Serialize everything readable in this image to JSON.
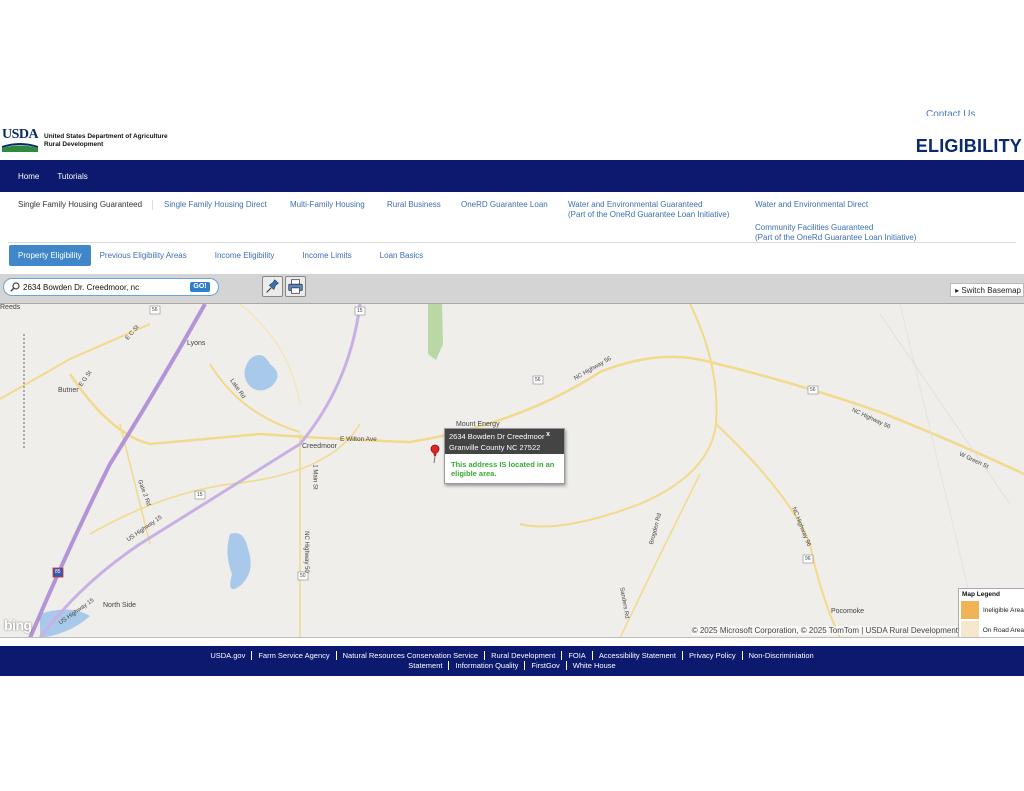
{
  "header": {
    "contact_label": "Contact Us",
    "logo_mark": "USDA",
    "agency_line1": "United States Department of Agriculture",
    "agency_line2": "Rural Development",
    "page_title": "ELIGIBILITY"
  },
  "topnav": [
    "Home",
    "Tutorials"
  ],
  "program_tabs": [
    "Single Family Housing Guaranteed",
    "Single Family Housing Direct",
    "Multi-Family Housing",
    "Rural Business",
    "OneRD Guarantee Loan",
    "Water and Environmental Guaranteed",
    "(Part of the OneRd Guarantee Loan Initiative)",
    "Water and Environmental Direct",
    "Community Facilities Guaranteed",
    "(Part of the OneRd Guarantee Loan Initiative)"
  ],
  "sub_tabs": [
    "Property Eligibility",
    "Previous Eligibility Areas",
    "Income Eligibility",
    "Income Limits",
    "Loan Basics"
  ],
  "toolbar": {
    "search_value": "2634 Bowden Dr. Creedmoor, nc",
    "go_label": "GO!",
    "switch_basemap": "Switch Basemap",
    "icons": [
      "pushpin-icon",
      "printer-icon"
    ]
  },
  "map": {
    "place_labels": [
      "Reeds",
      "Lyons",
      "Butner",
      "Creedmoor",
      "Mount Energy",
      "North Side",
      "Pocomoke"
    ],
    "road_labels": [
      "E C St",
      "E G St",
      "Lake Rd",
      "E Wilton Ave",
      "NC Highway 56",
      "NC Highway 56",
      "W Green St",
      "Gate 2 Rd",
      "US Highway 15",
      "US Highway 15",
      "1 Main St",
      "NC Highway 50",
      "NC Highway 96",
      "Brogden Rd",
      "Sanders Rd"
    ],
    "shields": [
      "15",
      "56",
      "56",
      "56",
      "15",
      "50",
      "96",
      "85"
    ],
    "popup": {
      "address_line1": "2634 Bowden Dr Creedmoor",
      "address_line2": "Granville County NC 27522",
      "close_label": "x",
      "message": "This address IS located in an eligible area."
    },
    "attribution": "© 2025 Microsoft Corporation, © 2025 TomTom | USDA Rural Development",
    "bing_logo": "bing",
    "legend": {
      "title": "Map Legend",
      "items": [
        {
          "label": "Ineligible Area",
          "color": "#f0b355"
        },
        {
          "label": "On Road Area",
          "color": "#f7e7cf"
        }
      ]
    }
  },
  "footer": {
    "row1": [
      "USDA.gov",
      "Farm Service Agency",
      "Natural Resources Conservation Service",
      "Rural Development",
      "FOIA",
      "Accessibility Statement",
      "Privacy Policy",
      "Non-Discriminiation"
    ],
    "row2": [
      "Statement",
      "Information Quality",
      "FirstGov",
      "White House"
    ]
  },
  "colors": {
    "brand_navy": "#0b1a6e",
    "link_blue": "#3d6fb0",
    "active_tab": "#3f87c9",
    "eligible_green": "#3aaa35"
  }
}
